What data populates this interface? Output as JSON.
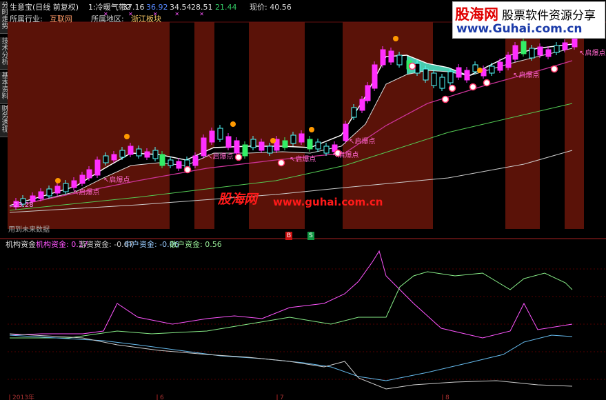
{
  "header": {
    "title": "生意宝(日线 前复权)",
    "indicator": "1:冷暖气带2",
    "v1": "37.16",
    "v2": "36.92",
    "v3": "34.54",
    "v4": "28.51",
    "v5": "21.44",
    "price": "现价: 40.56",
    "industry_label": "所属行业:",
    "industry": "互联网",
    "region_label": "所属地区:",
    "region": "浙江板块"
  },
  "side_tabs": [
    "分时走势",
    "技术分析",
    "基本资料",
    "财务透视"
  ],
  "main": {
    "low_price_label": "23.28",
    "signal_label": "启爆点",
    "bottom_note": "用到未来数据",
    "buy_marker": "B",
    "sell_marker": "S"
  },
  "sub": {
    "name": "机构资金",
    "values": [
      {
        "label": "机构资金: 0.17",
        "color": "#ff55ff"
      },
      {
        "label": "游资资金: -0.67",
        "color": "#cccccc"
      },
      {
        "label": "中户资金: -0.06",
        "color": "#99ccff"
      },
      {
        "label": "散户资金: 0.56",
        "color": "#99ee99"
      }
    ]
  },
  "x_axis": [
    "2013年",
    "6",
    "7",
    "8"
  ],
  "watermark": {
    "logo": "股海网",
    "slogan": "股票软件资源分享",
    "url": "www.Guhai.com.cn",
    "center_logo": "股海网",
    "center_url": "www.guhai.com.cn"
  },
  "colors": {
    "background": "#000000",
    "warm_band": "#5a1208",
    "up_candle": "#ff2fff",
    "down_candle": "#55ffff",
    "green_candle": "#33ee66",
    "signal_text": "#ff66cc",
    "watermark_red": "#ff1a1a"
  }
}
